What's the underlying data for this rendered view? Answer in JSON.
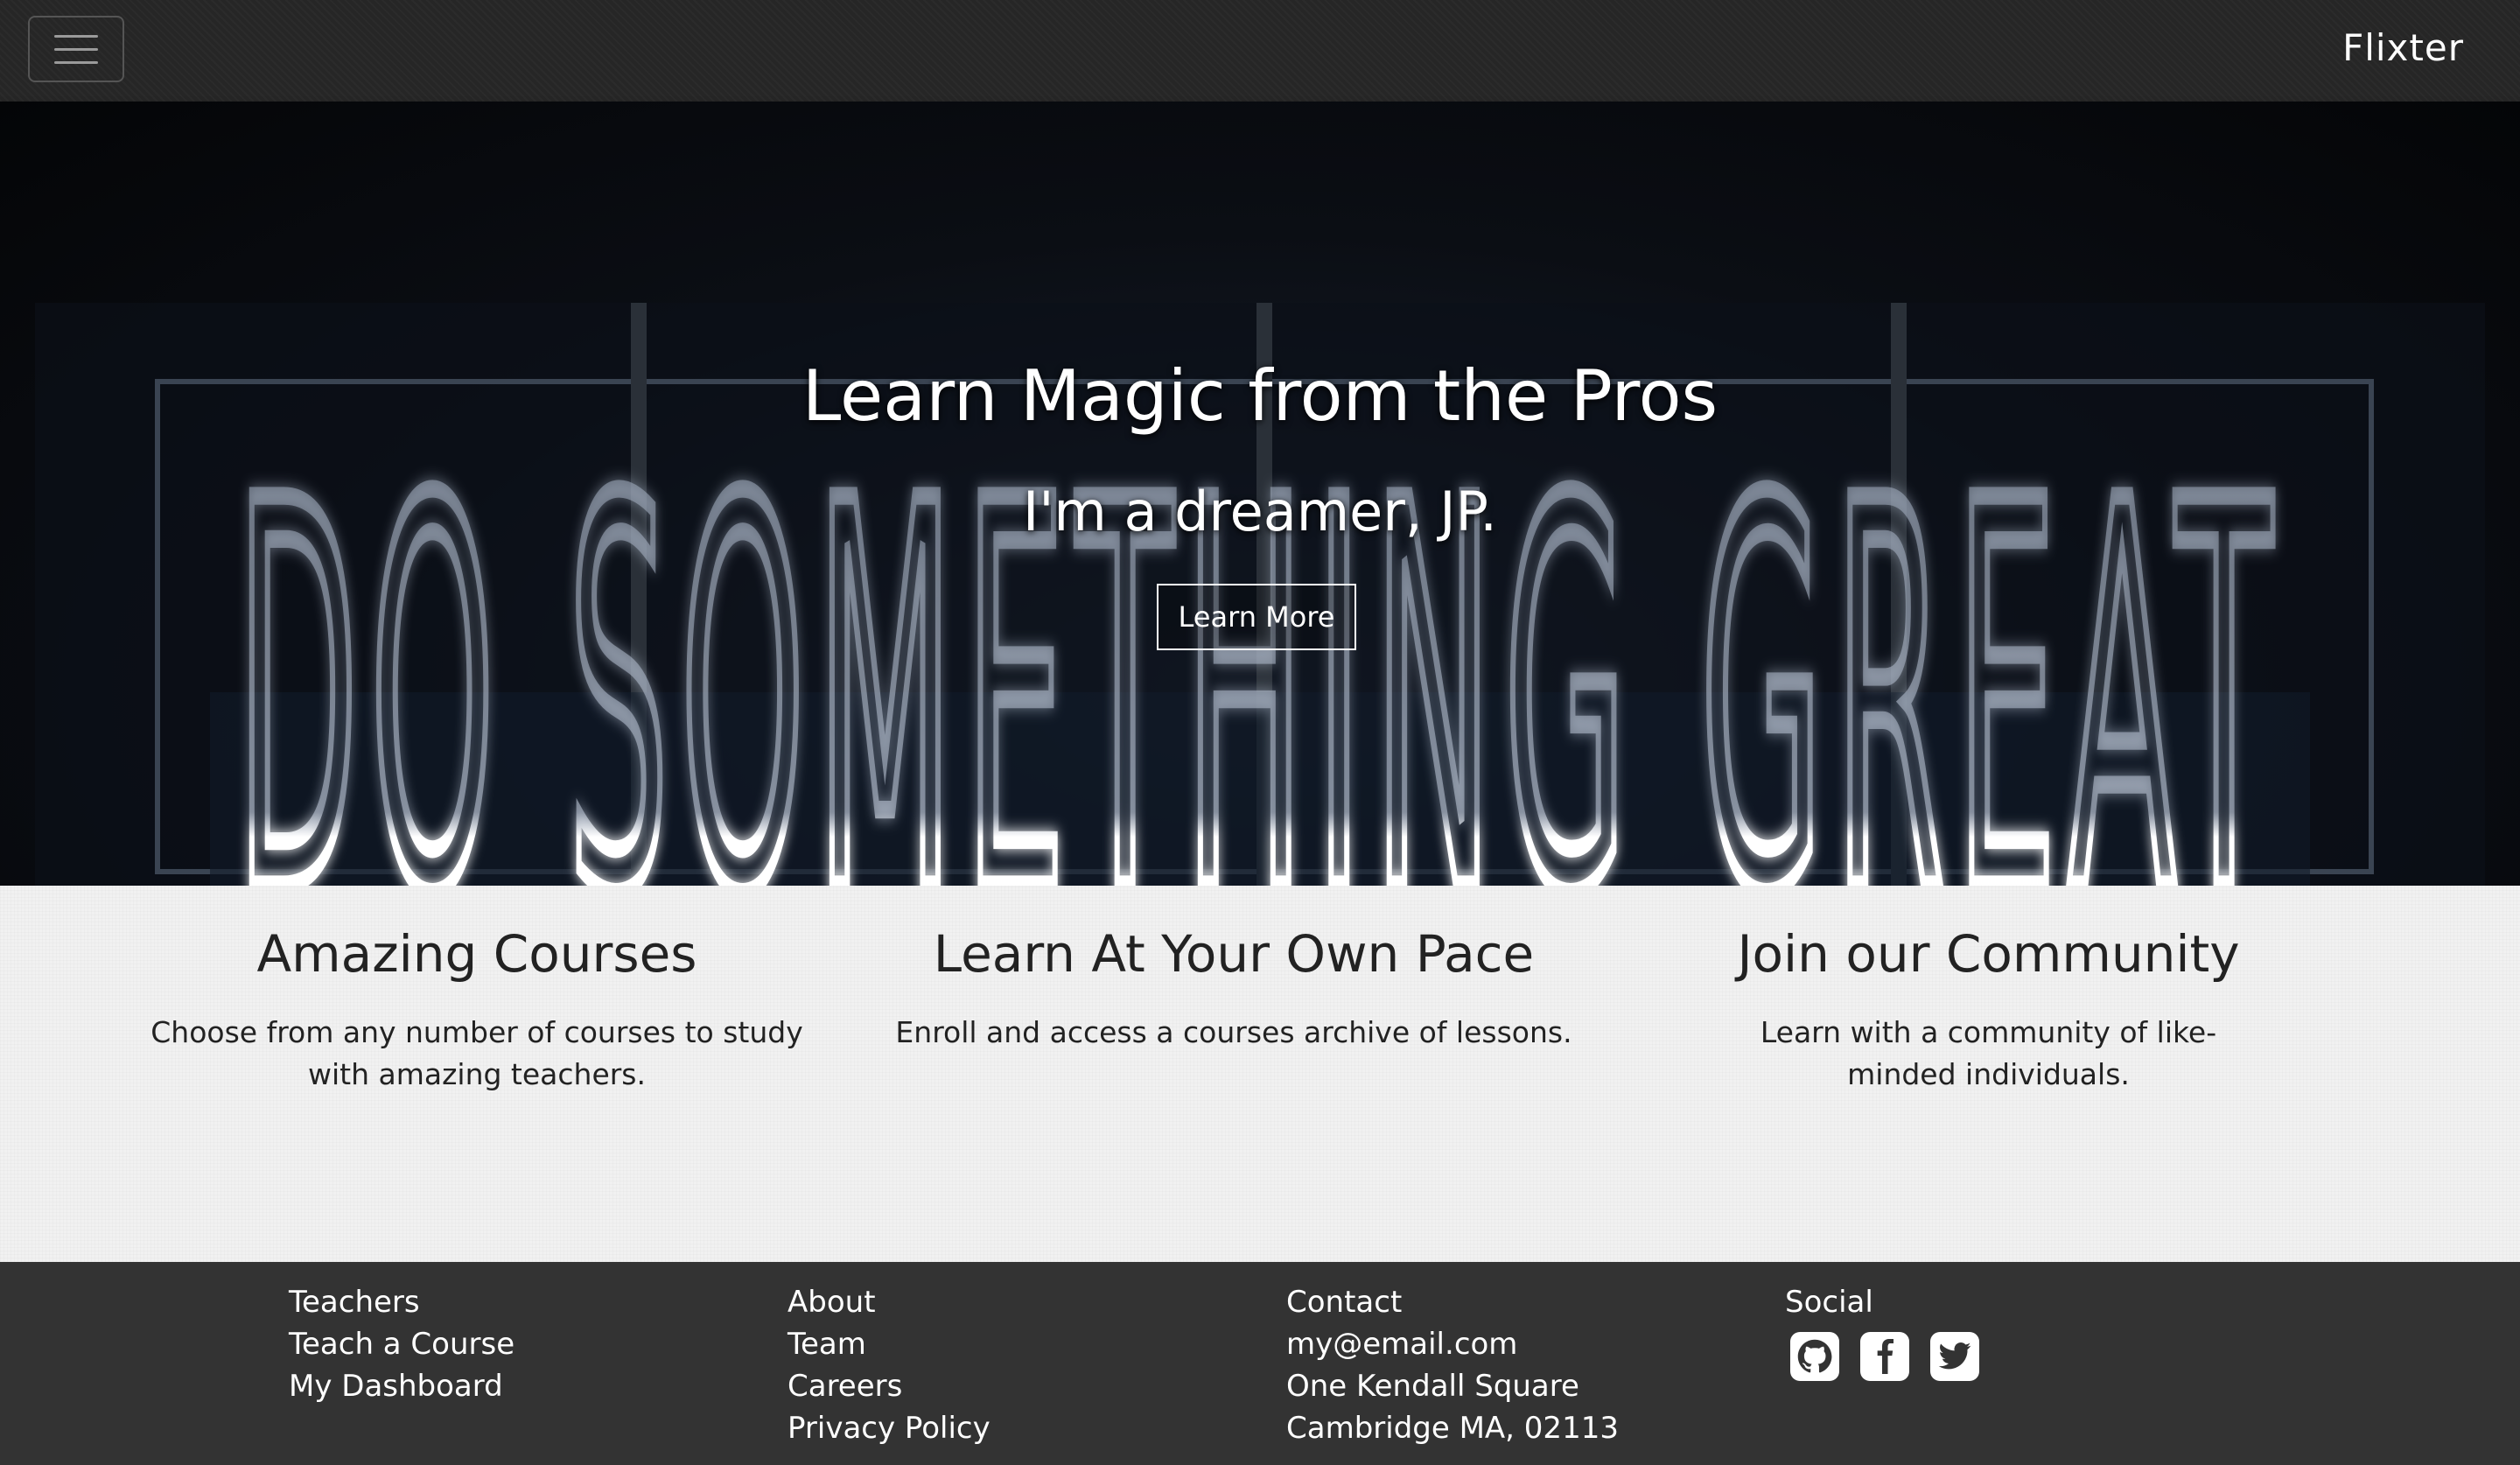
{
  "navbar": {
    "brand": "Flixter",
    "menu_icon": "hamburger-icon"
  },
  "hero": {
    "title": "Learn Magic from the Pros",
    "subtitle": "I'm a dreamer, JP.",
    "button_label": "Learn More",
    "neon_text": "DO SOMETHING GREAT"
  },
  "features": [
    {
      "title": "Amazing Courses",
      "text": "Choose from any number of courses to study with amazing teachers."
    },
    {
      "title": "Learn At Your Own Pace",
      "text": "Enroll and access a courses archive of lessons."
    },
    {
      "title": "Join our Community",
      "text": "Learn with a community of like-minded individuals."
    }
  ],
  "footer": {
    "teachers": {
      "heading": "Teachers",
      "links": [
        "Teach a Course",
        "My Dashboard"
      ]
    },
    "about": {
      "heading": "About",
      "links": [
        "Team",
        "Careers",
        "Privacy Policy"
      ]
    },
    "contact": {
      "heading": "Contact",
      "lines": [
        "my@email.com",
        "One Kendall Square",
        "Cambridge MA, 02113"
      ]
    },
    "social": {
      "heading": "Social",
      "icons": [
        "github-icon",
        "facebook-icon",
        "twitter-icon"
      ]
    }
  },
  "colors": {
    "navbar": "#262626",
    "footer": "#333333",
    "features_bg": "#f1f1f1",
    "text_dark": "#222222"
  }
}
